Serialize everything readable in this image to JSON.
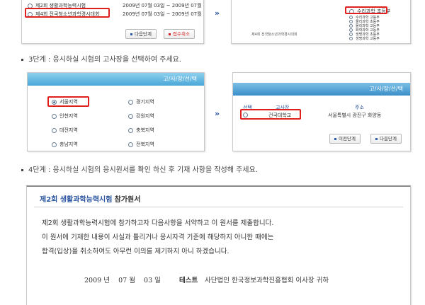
{
  "step2": {
    "rows": [
      {
        "name": "제2회 생활과학능력시험",
        "date": "2009년 07월 03일 ~ 2009년 07월 1"
      },
      {
        "name": "제4회 전국청소년과학경시대회",
        "date": "2009년 07월 03일 ~ 2009년 07월 1"
      }
    ],
    "buttons": {
      "next": "다음단계",
      "cancel": "접수취소"
    },
    "right_selected": "수리과학 초등부",
    "right_items": [
      "수리과학 고등부",
      "물리과학 초등부",
      "물리과학 고등부",
      "화학과학 고등부",
      "생명과학 초등부",
      "생명과학 고등부"
    ],
    "right_caption": "제4회 전국청소년과학경시대회"
  },
  "step3": {
    "label": "3단계 : 응시하실 시험의 고사장을 선택하여 주세요.",
    "banner": "고/사/장/선/택",
    "regions": [
      [
        "서울지역",
        "경기지역"
      ],
      [
        "인천지역",
        "강원지역"
      ],
      [
        "대전지역",
        "충북지역"
      ],
      [
        "충남지역",
        "전북지역"
      ]
    ],
    "right_banner": "고/사/장/선/택",
    "col_select": "선택",
    "col_site": "고사장",
    "col_address": "주소",
    "site_name": "건국대학교",
    "site_address": "서울특별시 광진구 화양동",
    "buttons": {
      "prev": "이전단계",
      "next": "다음단계"
    }
  },
  "step4": {
    "label": "4단계 : 응시하실 시험의 응시원서를 확인 하신 후 기재 사항을 작성해 주세요.",
    "form_title_blue": "제2회 생활과학능력시험",
    "form_title_dark": "참가원서",
    "lines": [
      "제2회 생활과학능력시험에 참가하고자 다음사항을 서약하고 이 원서를 제출합니다.",
      "이 원서에 기재한 내용이 사실과 틀리거나 응시자격 기준에 해당하지 아니한 때에는",
      "합격(입상)을 취소하여도 아무런 이의를 제기하지 아니 하겠습니다."
    ],
    "date_year": "2009",
    "date_year_unit": "년",
    "date_month": "07",
    "date_month_unit": "월",
    "date_day": "03",
    "date_day_unit": "일",
    "signer": "테스트",
    "recipient": "사단법인 한국정보과학진흥협회 이사장 귀하"
  },
  "colors": {
    "highlight": "#e0201f",
    "accent": "#2b56a0",
    "banner": "#4aa6d8"
  },
  "icons": {
    "arrow": "double-chevron-right-icon",
    "radio": "radio-icon"
  }
}
